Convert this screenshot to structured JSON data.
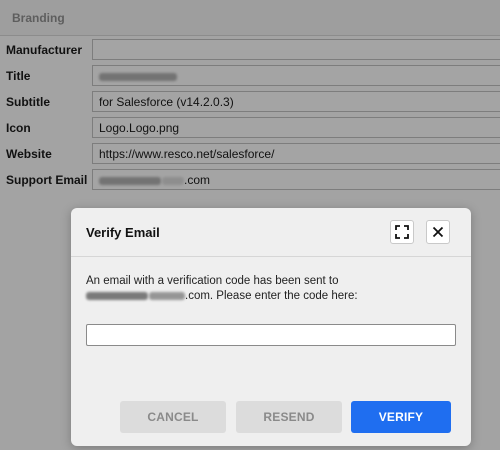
{
  "section": {
    "title": "Branding"
  },
  "fields": [
    {
      "label": "Manufacturer",
      "value": ""
    },
    {
      "label": "Title",
      "value": ""
    },
    {
      "label": "Subtitle",
      "value": "for Salesforce (v14.2.0.3)"
    },
    {
      "label": "Icon",
      "value": "Logo.Logo.png"
    },
    {
      "label": "Website",
      "value": "https://www.resco.net/salesforce/"
    },
    {
      "label": "Support Email",
      "value": ".com"
    }
  ],
  "dialog": {
    "title": "Verify Email",
    "maximize_icon": "expand-icon",
    "close_icon": "close-icon",
    "message_line1": "An email with a verification code has been sent to",
    "message_line2_suffix": ".com. Please enter the code here:",
    "code_value": "",
    "buttons": {
      "cancel": "CANCEL",
      "resend": "RESEND",
      "verify": "VERIFY"
    }
  },
  "colors": {
    "primary": "#1f6ef0",
    "overlay": "#a3a3a3",
    "dialog_bg": "#efefef"
  }
}
